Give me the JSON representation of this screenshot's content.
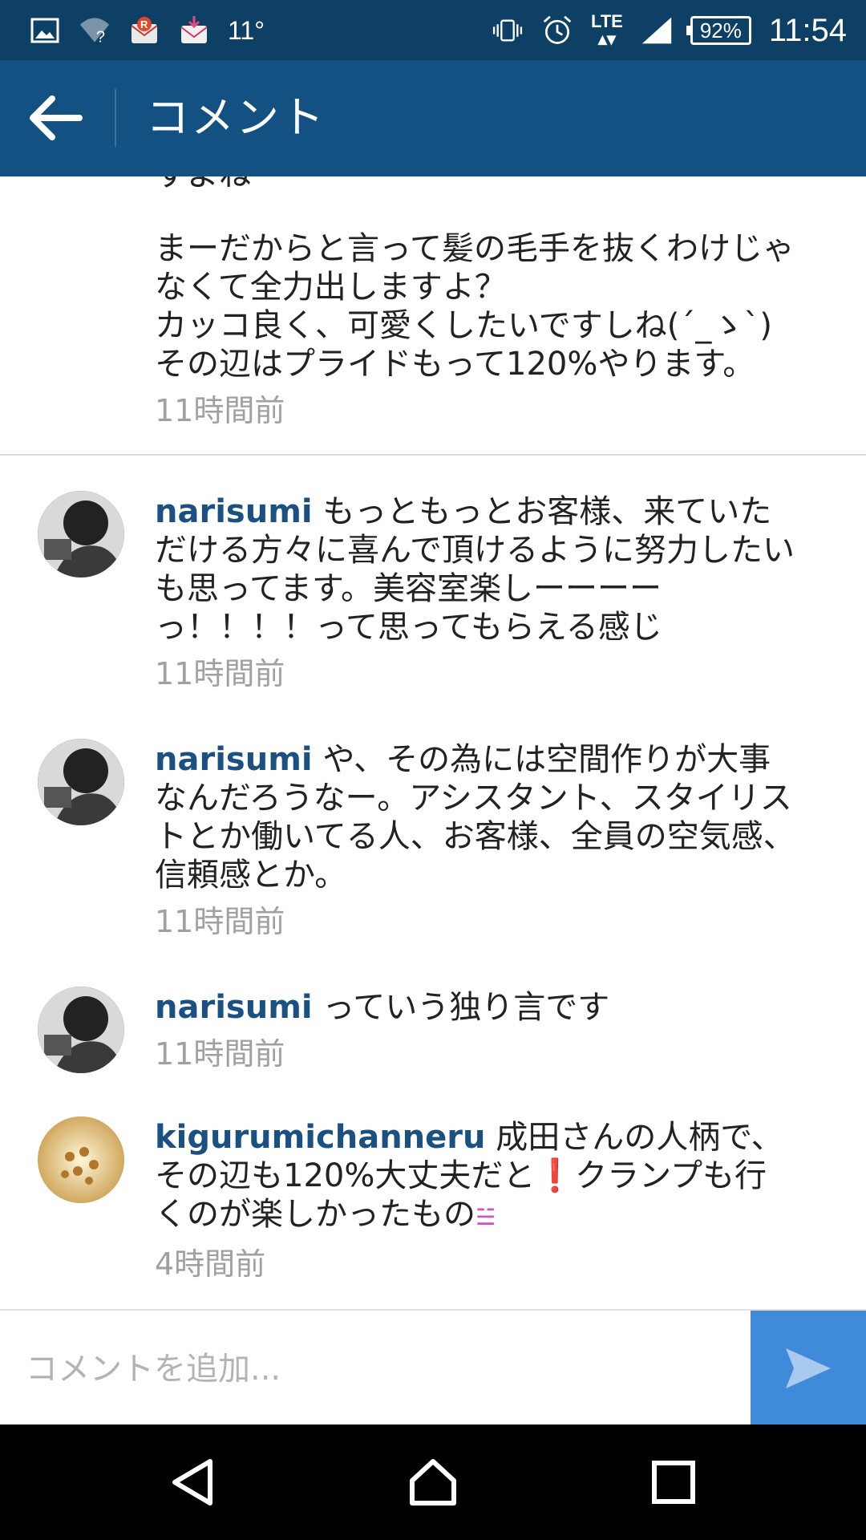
{
  "status_bar": {
    "temperature": "11°",
    "network": "LTE",
    "battery": "92%",
    "time": "11:54"
  },
  "app_bar": {
    "title": "コメント"
  },
  "first_comment": {
    "cut_text": "すよね",
    "text": "まーだからと言って髪の毛手を抜くわけじゃなくて全力出しますよ？\nカッコ良く、可愛くしたいですしね(´_ゝ`)\nその辺はプライドもって120%やります。",
    "time": "11時間前"
  },
  "comments": [
    {
      "username": "narisumi",
      "text": "もっともっとお客様、来ていただける方々に喜んで頂けるように努力したいも思ってます。美容室楽しーーーーっ！！！！って思ってもらえる感じ",
      "time": "11時間前"
    },
    {
      "username": "narisumi",
      "text": "や、その為には空間作りが大事なんだろうなー。アシスタント、スタイリストとか働いてる人、お客様、全員の空気感、信頼感とか。",
      "time": "11時間前"
    },
    {
      "username": "narisumi",
      "text": "っていう独り言です",
      "time": "11時間前"
    },
    {
      "username": "kigurumichanneru",
      "text_a": "成田さんの人柄で、その辺も120%大丈夫だと",
      "emoji_a": "❗",
      "text_b": "クランプも行くのが楽しかったもの",
      "emoji_b": "☱",
      "time": "4時間前"
    }
  ],
  "input": {
    "placeholder": "コメントを追加..."
  },
  "icons": {
    "status_left": [
      "image-icon",
      "wifi-unknown-icon",
      "rakuten-notification-icon",
      "mail-download-icon"
    ],
    "status_right": [
      "vibrate-icon",
      "alarm-icon",
      "signal-icon",
      "battery-icon"
    ],
    "back": "arrow-left-icon",
    "send": "send-icon",
    "nav": [
      "nav-back-icon",
      "nav-home-icon",
      "nav-recents-icon"
    ]
  },
  "colors": {
    "status_bar": "#0e3f64",
    "app_bar": "#135183",
    "username": "#1b5182",
    "send_button": "#3f8ad9",
    "timestamp": "#a0a0a0"
  }
}
